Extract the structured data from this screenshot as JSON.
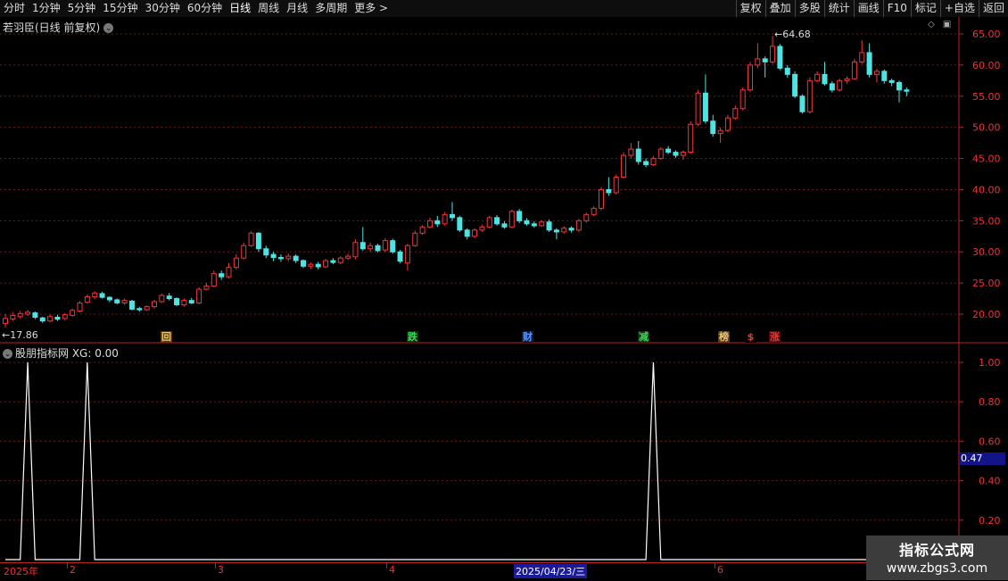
{
  "toolbar": {
    "left": [
      "分时",
      "1分钟",
      "5分钟",
      "15分钟",
      "30分钟",
      "60分钟",
      "日线",
      "周线",
      "月线",
      "多周期",
      "更多 >"
    ],
    "active": "日线",
    "right": [
      "复权",
      "叠加",
      "多股",
      "统计",
      "画线",
      "F10",
      "标记",
      "+自选",
      "返回"
    ]
  },
  "main_title": "若羽臣(日线 前复权)",
  "indicator_title": "股朋指标网 XG: 0.00",
  "price_axis": [
    "65.00",
    "60.00",
    "55.00",
    "50.00",
    "45.00",
    "40.00",
    "35.00",
    "30.00",
    "25.00",
    "20.00"
  ],
  "indicator_axis": [
    "1.00",
    "0.80",
    "0.60",
    "0.40",
    "0.20"
  ],
  "indicator_current": "0.47",
  "high_label": "64.68",
  "low_label": "17.86",
  "event_tags": [
    {
      "text": "回",
      "color": "#e7c777",
      "bg": "#5a3a10"
    },
    {
      "text": "跌",
      "color": "#33dd55",
      "bg": "#103010"
    },
    {
      "text": "财",
      "color": "#5599ff",
      "bg": "#101840"
    },
    {
      "text": "减",
      "color": "#33dd55",
      "bg": "#103010"
    },
    {
      "text": "榜",
      "color": "#e7c777",
      "bg": "#5a3a10"
    },
    {
      "text": "$",
      "color": "#ee3333",
      "bg": "#000000"
    },
    {
      "text": "涨",
      "color": "#ee3333",
      "bg": "#401010"
    }
  ],
  "date_labels": [
    "2025年",
    "2",
    "3",
    "4",
    "2025/04/23/三",
    "6"
  ],
  "watermark": {
    "line1": "指标公式网",
    "line2": "www.zbgs3.com"
  },
  "chart_data": {
    "type": "candlestick",
    "ylim": [
      16,
      67
    ],
    "candles": [
      [
        18.5,
        19.3,
        20.0,
        17.86
      ],
      [
        19.2,
        19.8,
        20.3,
        18.9
      ],
      [
        19.6,
        20.1,
        20.5,
        19.3
      ],
      [
        20.0,
        20.3,
        20.7,
        19.7
      ],
      [
        20.2,
        19.5,
        20.4,
        19.2
      ],
      [
        19.4,
        18.9,
        19.6,
        18.6
      ],
      [
        18.9,
        19.6,
        19.9,
        18.7
      ],
      [
        19.5,
        19.2,
        19.9,
        18.9
      ],
      [
        19.3,
        19.9,
        20.2,
        19.0
      ],
      [
        19.8,
        20.6,
        20.9,
        19.6
      ],
      [
        20.5,
        21.8,
        22.1,
        20.3
      ],
      [
        21.9,
        22.8,
        23.2,
        21.7
      ],
      [
        22.8,
        23.4,
        23.7,
        22.4
      ],
      [
        23.3,
        22.7,
        23.6,
        22.5
      ],
      [
        22.7,
        22.3,
        22.9,
        21.9
      ],
      [
        22.3,
        21.8,
        22.5,
        21.6
      ],
      [
        21.8,
        22.2,
        22.5,
        21.5
      ],
      [
        22.1,
        20.8,
        22.3,
        20.6
      ],
      [
        20.9,
        20.7,
        21.2,
        20.4
      ],
      [
        20.7,
        21.2,
        21.4,
        20.5
      ],
      [
        21.2,
        22.0,
        22.3,
        20.9
      ],
      [
        22.0,
        23.0,
        23.3,
        21.8
      ],
      [
        22.9,
        22.5,
        23.4,
        22.2
      ],
      [
        22.5,
        21.5,
        22.7,
        21.3
      ],
      [
        21.5,
        22.2,
        22.5,
        21.2
      ],
      [
        22.2,
        21.8,
        22.6,
        21.6
      ],
      [
        21.8,
        24.0,
        24.3,
        21.6
      ],
      [
        24.0,
        24.5,
        25.0,
        23.8
      ],
      [
        24.5,
        26.5,
        27.0,
        24.3
      ],
      [
        26.5,
        26.0,
        27.0,
        25.5
      ],
      [
        26.0,
        27.5,
        28.2,
        25.7
      ],
      [
        27.5,
        29.0,
        29.6,
        27.2
      ],
      [
        29.0,
        31.0,
        31.5,
        28.8
      ],
      [
        31.0,
        33.0,
        33.3,
        30.8
      ],
      [
        33.0,
        30.5,
        33.2,
        30.0
      ],
      [
        30.5,
        29.5,
        31.0,
        29.0
      ],
      [
        29.6,
        29.1,
        30.0,
        28.5
      ],
      [
        29.1,
        28.9,
        29.6,
        28.4
      ],
      [
        28.9,
        29.3,
        29.7,
        28.5
      ],
      [
        29.3,
        28.6,
        29.6,
        28.2
      ],
      [
        28.6,
        27.7,
        28.8,
        27.4
      ],
      [
        27.7,
        28.0,
        28.3,
        27.2
      ],
      [
        28.0,
        27.6,
        28.4,
        27.2
      ],
      [
        27.6,
        28.6,
        28.9,
        27.4
      ],
      [
        28.6,
        28.3,
        29.0,
        28.0
      ],
      [
        28.3,
        29.0,
        29.3,
        28.0
      ],
      [
        29.0,
        29.3,
        29.7,
        28.7
      ],
      [
        29.2,
        31.5,
        32.0,
        28.8
      ],
      [
        31.5,
        30.5,
        34.0,
        30.2
      ],
      [
        30.5,
        31.0,
        31.5,
        30.0
      ],
      [
        31.0,
        30.2,
        31.3,
        29.9
      ],
      [
        30.3,
        31.8,
        32.2,
        30.0
      ],
      [
        31.8,
        30.0,
        32.1,
        29.7
      ],
      [
        30.0,
        28.5,
        30.3,
        28.2
      ],
      [
        28.2,
        31.0,
        31.3,
        27.0
      ],
      [
        31.0,
        33.0,
        33.4,
        30.8
      ],
      [
        33.0,
        34.0,
        34.3,
        32.7
      ],
      [
        34.0,
        35.0,
        35.5,
        33.8
      ],
      [
        35.0,
        34.5,
        35.8,
        34.0
      ],
      [
        34.5,
        36.0,
        36.4,
        34.2
      ],
      [
        36.0,
        35.5,
        38.0,
        35.0
      ],
      [
        35.5,
        33.5,
        35.8,
        33.2
      ],
      [
        33.5,
        32.5,
        33.8,
        32.0
      ],
      [
        32.5,
        33.5,
        33.8,
        32.2
      ],
      [
        33.5,
        34.0,
        34.4,
        33.2
      ],
      [
        34.0,
        35.5,
        35.8,
        33.8
      ],
      [
        35.5,
        34.5,
        35.9,
        34.2
      ],
      [
        34.5,
        34.0,
        34.9,
        33.7
      ],
      [
        34.0,
        36.5,
        36.8,
        33.8
      ],
      [
        36.5,
        35.0,
        36.9,
        34.6
      ],
      [
        35.0,
        34.5,
        35.4,
        34.2
      ],
      [
        34.5,
        34.2,
        34.9,
        33.9
      ],
      [
        34.2,
        34.8,
        35.1,
        34.0
      ],
      [
        34.8,
        33.5,
        35.2,
        33.2
      ],
      [
        33.5,
        33.2,
        33.8,
        32.0
      ],
      [
        33.2,
        33.8,
        34.1,
        32.9
      ],
      [
        33.8,
        33.5,
        34.1,
        33.1
      ],
      [
        33.5,
        35.0,
        35.3,
        33.2
      ],
      [
        35.0,
        36.0,
        36.3,
        34.7
      ],
      [
        36.0,
        37.0,
        37.3,
        35.7
      ],
      [
        37.0,
        40.0,
        40.4,
        36.7
      ],
      [
        40.0,
        39.5,
        42.0,
        39.0
      ],
      [
        39.5,
        42.0,
        42.4,
        39.2
      ],
      [
        42.0,
        45.5,
        46.0,
        41.8
      ],
      [
        45.5,
        46.5,
        47.5,
        45.0
      ],
      [
        46.5,
        44.5,
        47.8,
        44.0
      ],
      [
        44.5,
        44.0,
        45.0,
        43.6
      ],
      [
        44.0,
        45.0,
        45.4,
        43.8
      ],
      [
        45.0,
        46.5,
        46.8,
        44.8
      ],
      [
        46.5,
        46.0,
        47.0,
        45.7
      ],
      [
        46.0,
        45.5,
        46.3,
        45.1
      ],
      [
        45.5,
        46.0,
        46.3,
        44.8
      ],
      [
        46.0,
        50.5,
        51.0,
        45.7
      ],
      [
        50.5,
        55.5,
        56.0,
        50.2
      ],
      [
        55.5,
        51.0,
        58.5,
        50.6
      ],
      [
        51.0,
        49.0,
        52.0,
        48.5
      ],
      [
        49.0,
        49.5,
        50.0,
        47.5
      ],
      [
        49.5,
        51.5,
        52.0,
        49.2
      ],
      [
        51.5,
        53.0,
        53.5,
        51.2
      ],
      [
        53.0,
        56.0,
        56.4,
        52.7
      ],
      [
        56.0,
        60.0,
        60.5,
        55.7
      ],
      [
        60.0,
        61.0,
        63.5,
        59.5
      ],
      [
        61.0,
        60.5,
        61.4,
        58.0
      ],
      [
        60.5,
        63.0,
        64.68,
        60.2
      ],
      [
        63.0,
        59.5,
        63.4,
        59.2
      ],
      [
        59.5,
        58.5,
        60.0,
        58.0
      ],
      [
        58.5,
        55.0,
        59.0,
        54.7
      ],
      [
        55.0,
        52.5,
        55.3,
        52.2
      ],
      [
        52.5,
        57.5,
        58.0,
        52.2
      ],
      [
        57.5,
        58.5,
        59.0,
        57.2
      ],
      [
        58.5,
        57.0,
        60.5,
        56.7
      ],
      [
        57.0,
        56.0,
        57.4,
        55.6
      ],
      [
        56.0,
        57.5,
        57.8,
        55.7
      ],
      [
        57.5,
        57.8,
        58.2,
        57.0
      ],
      [
        57.8,
        60.5,
        61.0,
        57.6
      ],
      [
        60.5,
        62.0,
        64.0,
        60.2
      ],
      [
        62.0,
        58.5,
        63.5,
        58.0
      ],
      [
        58.5,
        59.0,
        59.4,
        57.2
      ],
      [
        59.0,
        57.5,
        59.3,
        57.0
      ],
      [
        57.5,
        57.2,
        57.8,
        56.6
      ],
      [
        57.2,
        56.0,
        57.5,
        54.0
      ],
      [
        56.0,
        55.8,
        56.4,
        55.0
      ]
    ],
    "xg_signal": [
      0,
      0,
      0,
      1,
      0,
      0,
      0,
      0,
      0,
      0,
      0,
      1,
      0,
      0,
      0,
      0,
      0,
      0,
      0,
      0,
      0,
      0,
      0,
      0,
      0,
      0,
      0,
      0,
      0,
      0,
      0,
      0,
      0,
      0,
      0,
      0,
      0,
      0,
      0,
      0,
      0,
      0,
      0,
      0,
      0,
      0,
      0,
      0,
      0,
      0,
      0,
      0,
      0,
      0,
      0,
      0,
      0,
      0,
      0,
      0,
      0,
      0,
      0,
      0,
      0,
      0,
      0,
      0,
      0,
      0,
      0,
      0,
      0,
      0,
      0,
      0,
      0,
      0,
      0,
      0,
      0,
      0,
      0,
      0,
      0,
      0,
      0,
      1,
      0,
      0,
      0,
      0,
      0,
      0,
      0,
      0,
      0,
      0,
      0,
      0,
      0,
      0,
      0,
      0,
      0,
      0,
      0,
      0,
      0,
      0,
      0,
      0,
      0,
      0,
      0,
      0,
      0,
      0,
      0,
      0,
      0,
      0,
      0,
      0,
      0,
      0,
      0,
      0,
      0,
      0,
      0,
      0,
      0,
      0,
      0,
      0,
      0,
      0,
      0,
      0,
      0,
      0,
      0,
      0
    ],
    "xg_signal_note": "XG pulses 0→1"
  }
}
